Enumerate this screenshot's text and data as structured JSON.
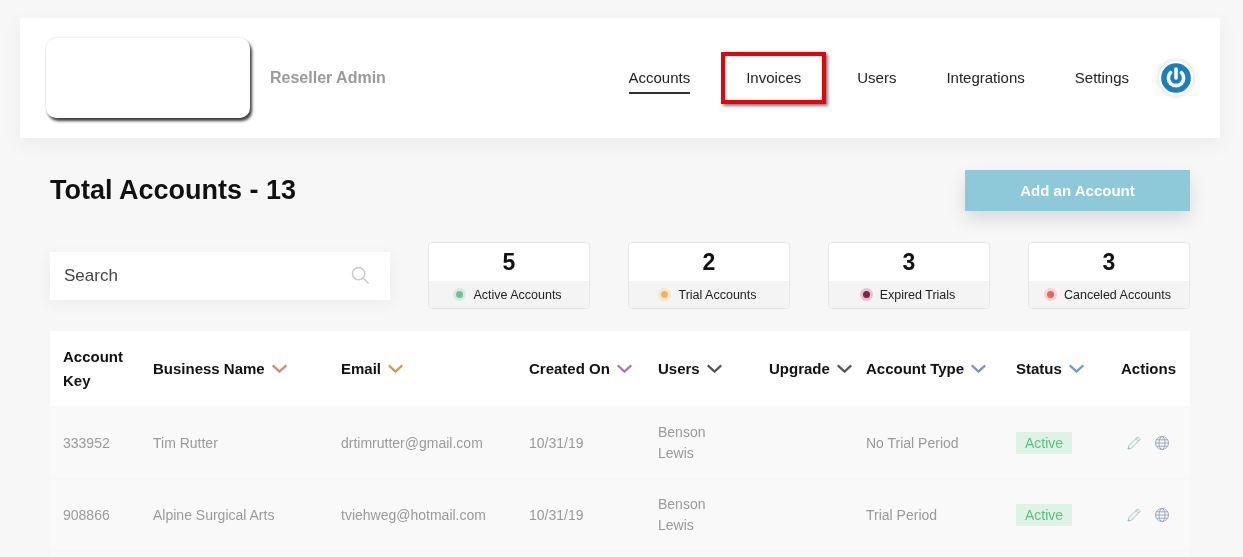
{
  "header": {
    "subtitle": "Reseller Admin",
    "nav": [
      {
        "label": "Accounts",
        "selected": true,
        "highlighted": false
      },
      {
        "label": "Invoices",
        "selected": false,
        "highlighted": true
      },
      {
        "label": "Users",
        "selected": false,
        "highlighted": false
      },
      {
        "label": "Integrations",
        "selected": false,
        "highlighted": false
      },
      {
        "label": "Settings",
        "selected": false,
        "highlighted": false
      }
    ]
  },
  "title": "Total Accounts - 13",
  "add_button": "Add an Account",
  "search": {
    "placeholder": "Search"
  },
  "stats": [
    {
      "count": "5",
      "label": "Active Accounts",
      "color": "#6cc58f"
    },
    {
      "count": "2",
      "label": "Trial Accounts",
      "color": "#f5b553"
    },
    {
      "count": "3",
      "label": "Expired Trials",
      "color": "#8e1a4a"
    },
    {
      "count": "3",
      "label": "Canceled Accounts",
      "color": "#f0605d"
    }
  ],
  "table": {
    "columns": [
      {
        "label": "Account Key",
        "sortable": false
      },
      {
        "label": "Business Name",
        "sortable": true,
        "color": "#d48a6a"
      },
      {
        "label": "Email",
        "sortable": true,
        "color": "#d49a4a"
      },
      {
        "label": "Created On",
        "sortable": true,
        "color": "#a07ab8"
      },
      {
        "label": "Users",
        "sortable": true,
        "color": "#555555"
      },
      {
        "label": "Upgrade",
        "sortable": true,
        "color": "#555555"
      },
      {
        "label": "Account Type",
        "sortable": true,
        "color": "#8a8ad0"
      },
      {
        "label": "Status",
        "sortable": true,
        "color": "#6a9ad8"
      },
      {
        "label": "Actions",
        "sortable": false
      }
    ],
    "rows": [
      {
        "key": "333952",
        "business": "Tim Rutter",
        "email": "drtimrutter@gmail.com",
        "created": "10/31/19",
        "users": [
          "Benson",
          "Lewis"
        ],
        "account_type": "No Trial Period",
        "status": "Active"
      },
      {
        "key": "908866",
        "business": "Alpine Surgical Arts",
        "email": "tviehweg@hotmail.com",
        "created": "10/31/19",
        "users": [
          "Benson",
          "Lewis"
        ],
        "account_type": "Trial Period",
        "status": "Active"
      }
    ]
  }
}
